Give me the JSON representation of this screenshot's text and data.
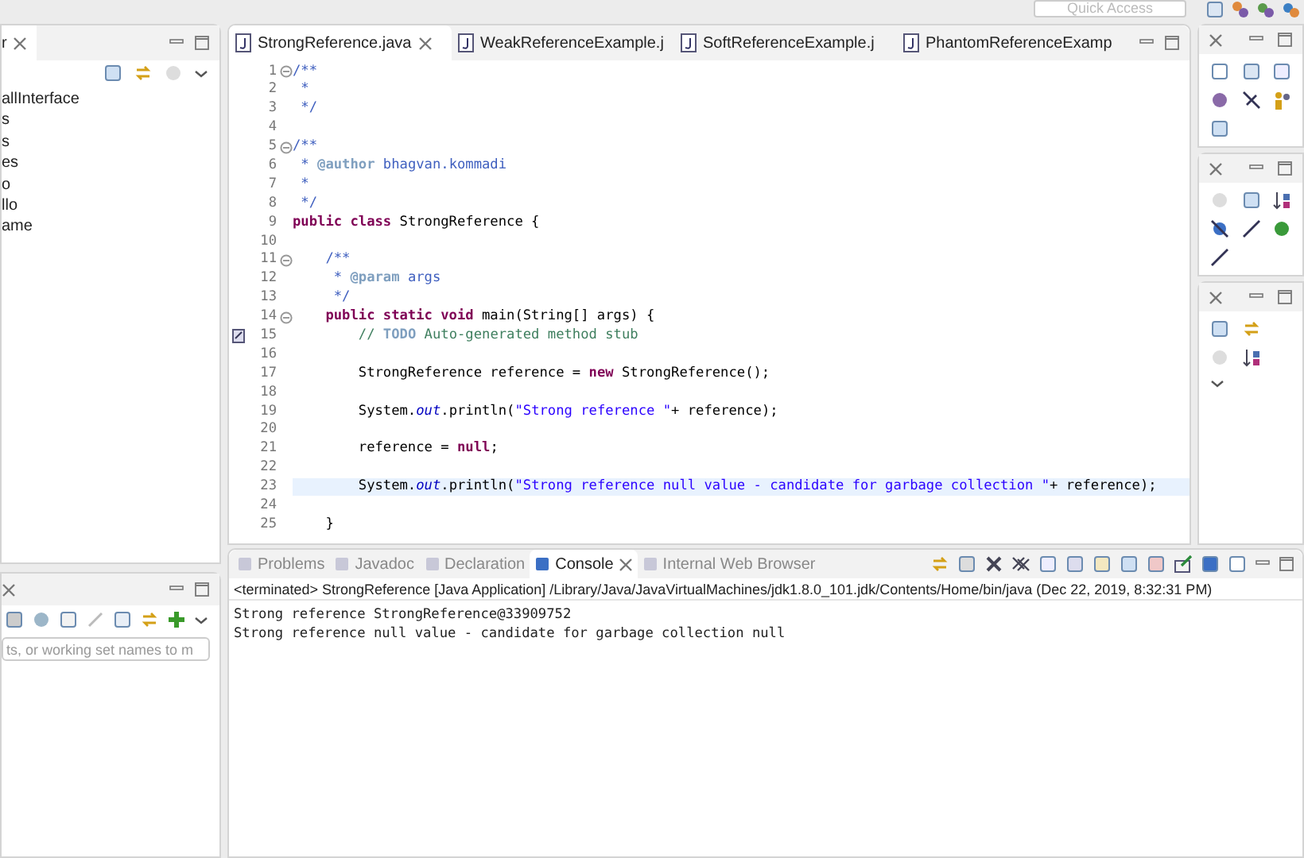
{
  "top_toolbar": {
    "quick_access": {
      "placeholder": "Quick Access"
    }
  },
  "left_panel": {
    "tab": {
      "label": "r",
      "selected": true
    },
    "tree": [
      {
        "label": "allInterface"
      },
      {
        "label": "s"
      },
      {
        "label": "s"
      },
      {
        "label": "es"
      },
      {
        "label": "o"
      },
      {
        "label": "llo"
      },
      {
        "label": "ame"
      }
    ]
  },
  "left_bottom_panel": {
    "filter": {
      "placeholder": "ts, or working set names to m"
    }
  },
  "editor": {
    "tabs": [
      {
        "label": "StrongReference.java",
        "selected": true
      },
      {
        "label": "WeakReferenceExample.j",
        "selected": false
      },
      {
        "label": "SoftReferenceExample.j",
        "selected": false
      },
      {
        "label": "PhantomReferenceExamp",
        "selected": false
      }
    ],
    "lines": [
      {
        "number": "1",
        "fold": true,
        "current": false,
        "task": false,
        "segments": [
          {
            "kind": "javadoc",
            "text": "/**"
          }
        ]
      },
      {
        "number": "2",
        "fold": false,
        "current": false,
        "task": false,
        "segments": [
          {
            "kind": "javadoc",
            "text": " *"
          }
        ]
      },
      {
        "number": "3",
        "fold": false,
        "current": false,
        "task": false,
        "segments": [
          {
            "kind": "javadoc",
            "text": " */"
          }
        ]
      },
      {
        "number": "4",
        "fold": false,
        "current": false,
        "task": false
      },
      {
        "number": "5",
        "fold": true,
        "current": false,
        "task": false,
        "segments": [
          {
            "kind": "javadoc",
            "text": "/**"
          }
        ]
      },
      {
        "number": "6",
        "fold": false,
        "current": false,
        "task": false,
        "segments": [
          {
            "kind": "javadoc",
            "text": " * "
          },
          {
            "kind": "tag",
            "text": "@author"
          },
          {
            "kind": "javadoc",
            "text": " bhagvan.kommadi"
          }
        ]
      },
      {
        "number": "7",
        "fold": false,
        "current": false,
        "task": false,
        "segments": [
          {
            "kind": "javadoc",
            "text": " *"
          }
        ]
      },
      {
        "number": "8",
        "fold": false,
        "current": false,
        "task": false,
        "segments": [
          {
            "kind": "javadoc",
            "text": " */"
          }
        ]
      },
      {
        "number": "9",
        "fold": false,
        "current": false,
        "task": false,
        "segments": [
          {
            "kind": "keyword",
            "text": "public class"
          },
          {
            "kind": "plain",
            "text": " StrongReference {"
          }
        ]
      },
      {
        "number": "10",
        "fold": false,
        "current": false,
        "task": false
      },
      {
        "number": "11",
        "fold": true,
        "current": false,
        "task": false,
        "segments": [
          {
            "kind": "javadoc",
            "text": "    /**"
          }
        ]
      },
      {
        "number": "12",
        "fold": false,
        "current": false,
        "task": false,
        "segments": [
          {
            "kind": "javadoc",
            "text": "     * "
          },
          {
            "kind": "tag",
            "text": "@param"
          },
          {
            "kind": "javadoc",
            "text": " args"
          }
        ]
      },
      {
        "number": "13",
        "fold": false,
        "current": false,
        "task": false,
        "segments": [
          {
            "kind": "javadoc",
            "text": "     */"
          }
        ]
      },
      {
        "number": "14",
        "fold": true,
        "current": false,
        "task": false,
        "segments": [
          {
            "kind": "keyword",
            "text": "    public static void"
          },
          {
            "kind": "plain",
            "text": " main(String[] args) {"
          }
        ]
      },
      {
        "number": "15",
        "fold": false,
        "current": false,
        "task": true,
        "segments": [
          {
            "kind": "comment",
            "text": "        // "
          },
          {
            "kind": "todo",
            "text": "TODO"
          },
          {
            "kind": "comment",
            "text": " Auto-generated method stub"
          }
        ]
      },
      {
        "number": "16",
        "fold": false,
        "current": false,
        "task": false
      },
      {
        "number": "17",
        "fold": false,
        "current": false,
        "task": false,
        "segments": [
          {
            "kind": "plain",
            "text": "        StrongReference reference = "
          },
          {
            "kind": "keyword",
            "text": "new"
          },
          {
            "kind": "plain",
            "text": " StrongReference();"
          }
        ]
      },
      {
        "number": "18",
        "fold": false,
        "current": false,
        "task": false
      },
      {
        "number": "19",
        "fold": false,
        "current": false,
        "task": false,
        "segments": [
          {
            "kind": "plain",
            "text": "        System."
          },
          {
            "kind": "field",
            "text": "out"
          },
          {
            "kind": "plain",
            "text": ".println("
          },
          {
            "kind": "string",
            "text": "\"Strong reference \""
          },
          {
            "kind": "plain",
            "text": "+ reference);"
          }
        ]
      },
      {
        "number": "20",
        "fold": false,
        "current": false,
        "task": false
      },
      {
        "number": "21",
        "fold": false,
        "current": false,
        "task": false,
        "segments": [
          {
            "kind": "plain",
            "text": "        reference = "
          },
          {
            "kind": "keyword",
            "text": "null"
          },
          {
            "kind": "plain",
            "text": ";"
          }
        ]
      },
      {
        "number": "22",
        "fold": false,
        "current": false,
        "task": false
      },
      {
        "number": "23",
        "fold": false,
        "current": true,
        "task": false,
        "segments": [
          {
            "kind": "plain",
            "text": "        System."
          },
          {
            "kind": "field",
            "text": "out"
          },
          {
            "kind": "plain",
            "text": ".println("
          },
          {
            "kind": "string",
            "text": "\"Strong reference null value - candidate for garbage collection \""
          },
          {
            "kind": "plain",
            "text": "+ reference);"
          }
        ]
      },
      {
        "number": "24",
        "fold": false,
        "current": false,
        "task": false
      },
      {
        "number": "25",
        "fold": false,
        "current": false,
        "task": false,
        "segments": [
          {
            "kind": "plain",
            "text": "    }"
          }
        ]
      }
    ]
  },
  "console": {
    "tabs": [
      {
        "label": "Problems",
        "selected": false
      },
      {
        "label": "Javadoc",
        "selected": false
      },
      {
        "label": "Declaration",
        "selected": false
      },
      {
        "label": "Console",
        "selected": true
      },
      {
        "label": "Internal Web Browser",
        "selected": false
      }
    ],
    "header": "<terminated> StrongReference [Java Application] /Library/Java/JavaVirtualMachines/jdk1.8.0_101.jdk/Contents/Home/bin/java (Dec 22, 2019, 8:32:31 PM)",
    "output": [
      "Strong reference StrongReference@33909752",
      "Strong reference null value - candidate for garbage collection null"
    ]
  }
}
